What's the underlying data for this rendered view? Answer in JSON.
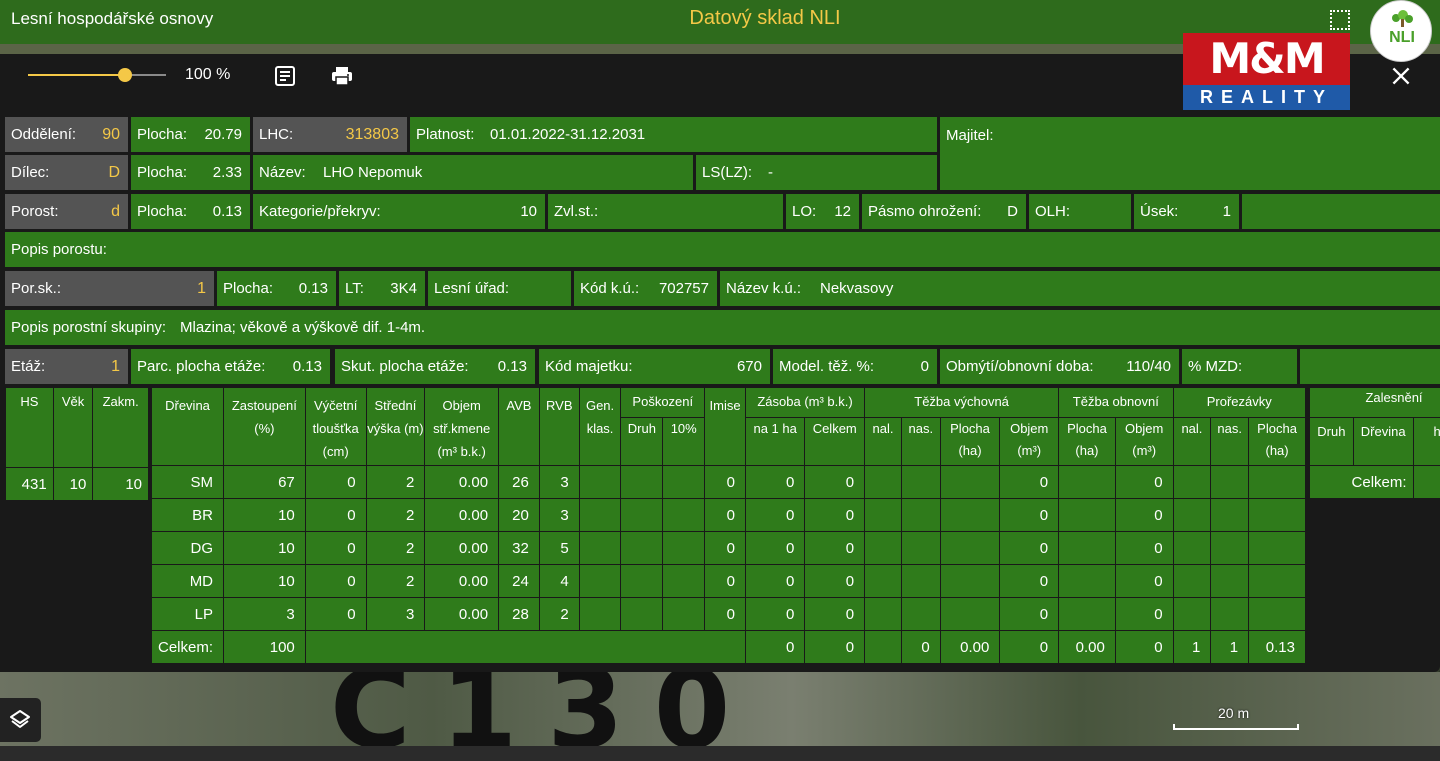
{
  "header": {
    "app_title": "Lesní hospodářské osnovy",
    "center_title": "Datový sklad NLI",
    "logo_text": "NLI"
  },
  "toolbar": {
    "zoom_label": "100 %",
    "zoom_percent": 100,
    "zoom_fill_fraction": 0.7
  },
  "watermark": {
    "top": "M&M",
    "bottom": "REALITY"
  },
  "row1": {
    "oddeleni_label": "Oddělení:",
    "oddeleni_value": "90",
    "plocha1_label": "Plocha:",
    "plocha1_value": "20.79",
    "lhc_label": "LHC:",
    "lhc_value": "313803",
    "platnost_label": "Platnost:",
    "platnost_value": "01.01.2022-31.12.2031",
    "majitel_label": "Majitel:"
  },
  "row2": {
    "dilec_label": "Dílec:",
    "dilec_value": "D",
    "plocha2_label": "Plocha:",
    "plocha2_value": "2.33",
    "nazev_label": "Název:",
    "nazev_value": "LHO Nepomuk",
    "ls_label": "LS(LZ):",
    "ls_value": "-"
  },
  "row3": {
    "porost_label": "Porost:",
    "porost_value": "d",
    "plocha3_label": "Plocha:",
    "plocha3_value": "0.13",
    "kategorie_label": "Kategorie/překryv:",
    "kategorie_value": "10",
    "zvlst_label": "Zvl.st.:",
    "lo_label": "LO:",
    "lo_value": "12",
    "pasmo_label": "Pásmo ohrožení:",
    "pasmo_value": "D",
    "olh_label": "OLH:",
    "usek_label": "Úsek:",
    "usek_value": "1"
  },
  "row4": {
    "popis_porostu_label": "Popis porostu:"
  },
  "row5": {
    "porsk_label": "Por.sk.:",
    "porsk_value": "1",
    "plocha5_label": "Plocha:",
    "plocha5_value": "0.13",
    "lt_label": "LT:",
    "lt_value": "3K4",
    "lesni_urad_label": "Lesní úřad:",
    "kod_ku_label": "Kód k.ú.:",
    "kod_ku_value": "702757",
    "nazev_ku_label": "Název k.ú.:",
    "nazev_ku_value": "Nekvasovy"
  },
  "row6": {
    "popis_skupiny_label": "Popis porostní skupiny:",
    "popis_skupiny_value": "Mlazina; věkově a výškově dif. 1-4m."
  },
  "row7": {
    "etaz_label": "Etáž:",
    "etaz_value": "1",
    "parc_label": "Parc. plocha etáže:",
    "parc_value": "0.13",
    "skut_label": "Skut. plocha etáže:",
    "skut_value": "0.13",
    "kod_majetku_label": "Kód majetku:",
    "kod_majetku_value": "670",
    "model_label": "Model. těž. %:",
    "model_value": "0",
    "obmyti_label": "Obmýtí/obnovní doba:",
    "obmyti_value": "110/40",
    "mzd_label": "% MZD:"
  },
  "hs_table": {
    "headers": [
      "HS",
      "Věk",
      "Zakm."
    ],
    "row": [
      "431",
      "10",
      "10"
    ]
  },
  "main_table": {
    "h": {
      "drevina": "Dřevina",
      "zastoupeni": "Zastoupení (%)",
      "vycetni": "Výčetní tloušťka (cm)",
      "stredni": "Střední výška (m)",
      "objem": "Objem stř.kmene (m³ b.k.)",
      "avb": "AVB",
      "rvb": "RVB",
      "gen": "Gen. klas.",
      "poskozeni": "Poškození",
      "druh": "Druh",
      "p10": "10%",
      "imise": "Imise",
      "zasoba": "Zásoba (m³ b.k.)",
      "na1ha": "na 1 ha",
      "celkem": "Celkem",
      "tezba_vych": "Těžba výchovná",
      "nal": "nal.",
      "nas": "nas.",
      "plocha_ha": "Plocha (ha)",
      "objem_m3": "Objem (m³)",
      "tezba_obn": "Těžba obnovní",
      "prorezavky": "Prořezávky"
    },
    "rows": [
      [
        "SM",
        "67",
        "0",
        "2",
        "0.00",
        "26",
        "3",
        "",
        "",
        "",
        "0",
        "0",
        "0",
        "",
        "",
        "",
        "0",
        "",
        "0",
        "",
        "",
        ""
      ],
      [
        "BR",
        "10",
        "0",
        "2",
        "0.00",
        "20",
        "3",
        "",
        "",
        "",
        "0",
        "0",
        "0",
        "",
        "",
        "",
        "0",
        "",
        "0",
        "",
        "",
        ""
      ],
      [
        "DG",
        "10",
        "0",
        "2",
        "0.00",
        "32",
        "5",
        "",
        "",
        "",
        "0",
        "0",
        "0",
        "",
        "",
        "",
        "0",
        "",
        "0",
        "",
        "",
        ""
      ],
      [
        "MD",
        "10",
        "0",
        "2",
        "0.00",
        "24",
        "4",
        "",
        "",
        "",
        "0",
        "0",
        "0",
        "",
        "",
        "",
        "0",
        "",
        "0",
        "",
        "",
        ""
      ],
      [
        "LP",
        "3",
        "0",
        "3",
        "0.00",
        "28",
        "2",
        "",
        "",
        "",
        "0",
        "0",
        "0",
        "",
        "",
        "",
        "0",
        "",
        "0",
        "",
        "",
        ""
      ]
    ],
    "total": {
      "label": "Celkem:",
      "zastoupeni": "100",
      "zasoba_na1ha": "0",
      "zasoba_celkem": "0",
      "tv_nal": "",
      "tv_nas": "0",
      "tv_plocha": "0.00",
      "tv_objem": "0",
      "to_plocha": "0.00",
      "to_objem": "0",
      "pr_nal": "1",
      "pr_nas": "1",
      "pr_plocha": "0.13"
    }
  },
  "zalesneni_table": {
    "title": "Zalesnění",
    "druh": "Druh",
    "drevina": "Dřevina",
    "h": "h",
    "total_label": "Celkem:"
  },
  "map": {
    "glyphs": "C130",
    "scale_label": "20 m"
  }
}
